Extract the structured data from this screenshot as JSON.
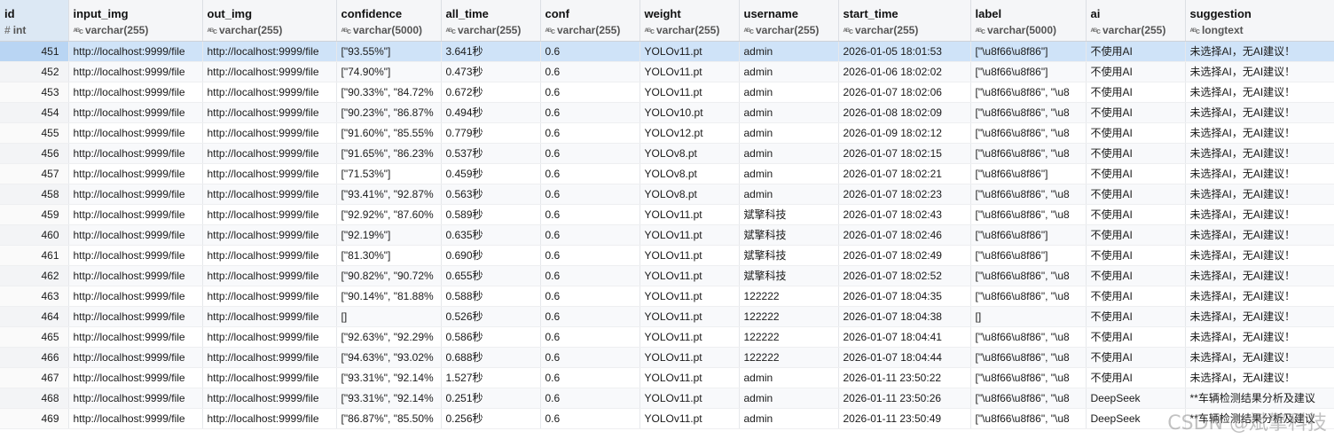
{
  "columns": [
    {
      "name": "id",
      "type": "int",
      "icon": "hash-icon"
    },
    {
      "name": "input_img",
      "type": "varchar(255)",
      "icon": "abc-icon"
    },
    {
      "name": "out_img",
      "type": "varchar(255)",
      "icon": "abc-icon"
    },
    {
      "name": "confidence",
      "type": "varchar(5000)",
      "icon": "abc-icon"
    },
    {
      "name": "all_time",
      "type": "varchar(255)",
      "icon": "abc-icon"
    },
    {
      "name": "conf",
      "type": "varchar(255)",
      "icon": "abc-icon"
    },
    {
      "name": "weight",
      "type": "varchar(255)",
      "icon": "abc-icon"
    },
    {
      "name": "username",
      "type": "varchar(255)",
      "icon": "abc-icon"
    },
    {
      "name": "start_time",
      "type": "varchar(255)",
      "icon": "abc-icon"
    },
    {
      "name": "label",
      "type": "varchar(5000)",
      "icon": "abc-icon"
    },
    {
      "name": "ai",
      "type": "varchar(255)",
      "icon": "abc-icon"
    },
    {
      "name": "suggestion",
      "type": "longtext",
      "icon": "abc-icon"
    }
  ],
  "type_icon_glyph": "ᴬᴮc",
  "hash_glyph": "#",
  "selected_row_index": 0,
  "colors": {
    "selected_row": "#cfe3f8",
    "header_bg": "#f5f6f8",
    "selected_header": "#dce8f4"
  },
  "rows": [
    [
      "451",
      "http://localhost:9999/file",
      "http://localhost:9999/file",
      "[\"93.55%\"]",
      "3.641秒",
      "0.6",
      "YOLOv11.pt",
      "admin",
      "2026-01-05 18:01:53",
      "[\"\\u8f66\\u8f86\"]",
      "不使用AI",
      "未选择AI，无AI建议！"
    ],
    [
      "452",
      "http://localhost:9999/file",
      "http://localhost:9999/file",
      "[\"74.90%\"]",
      "0.473秒",
      "0.6",
      "YOLOv11.pt",
      "admin",
      "2026-01-06 18:02:02",
      "[\"\\u8f66\\u8f86\"]",
      "不使用AI",
      "未选择AI，无AI建议！"
    ],
    [
      "453",
      "http://localhost:9999/file",
      "http://localhost:9999/file",
      "[\"90.33%\", \"84.72%",
      "0.672秒",
      "0.6",
      "YOLOv11.pt",
      "admin",
      "2026-01-07 18:02:06",
      "[\"\\u8f66\\u8f86\", \"\\u8",
      "不使用AI",
      "未选择AI，无AI建议！"
    ],
    [
      "454",
      "http://localhost:9999/file",
      "http://localhost:9999/file",
      "[\"90.23%\", \"86.87%",
      "0.494秒",
      "0.6",
      "YOLOv10.pt",
      "admin",
      "2026-01-08 18:02:09",
      "[\"\\u8f66\\u8f86\", \"\\u8",
      "不使用AI",
      "未选择AI，无AI建议！"
    ],
    [
      "455",
      "http://localhost:9999/file",
      "http://localhost:9999/file",
      "[\"91.60%\", \"85.55%",
      "0.779秒",
      "0.6",
      "YOLOv12.pt",
      "admin",
      "2026-01-09 18:02:12",
      "[\"\\u8f66\\u8f86\", \"\\u8",
      "不使用AI",
      "未选择AI，无AI建议！"
    ],
    [
      "456",
      "http://localhost:9999/file",
      "http://localhost:9999/file",
      "[\"91.65%\", \"86.23%",
      "0.537秒",
      "0.6",
      "YOLOv8.pt",
      "admin",
      "2026-01-07 18:02:15",
      "[\"\\u8f66\\u8f86\", \"\\u8",
      "不使用AI",
      "未选择AI，无AI建议！"
    ],
    [
      "457",
      "http://localhost:9999/file",
      "http://localhost:9999/file",
      "[\"71.53%\"]",
      "0.459秒",
      "0.6",
      "YOLOv8.pt",
      "admin",
      "2026-01-07 18:02:21",
      "[\"\\u8f66\\u8f86\"]",
      "不使用AI",
      "未选择AI，无AI建议！"
    ],
    [
      "458",
      "http://localhost:9999/file",
      "http://localhost:9999/file",
      "[\"93.41%\", \"92.87%",
      "0.563秒",
      "0.6",
      "YOLOv8.pt",
      "admin",
      "2026-01-07 18:02:23",
      "[\"\\u8f66\\u8f86\", \"\\u8",
      "不使用AI",
      "未选择AI，无AI建议！"
    ],
    [
      "459",
      "http://localhost:9999/file",
      "http://localhost:9999/file",
      "[\"92.92%\", \"87.60%",
      "0.589秒",
      "0.6",
      "YOLOv11.pt",
      "斌擎科技",
      "2026-01-07 18:02:43",
      "[\"\\u8f66\\u8f86\", \"\\u8",
      "不使用AI",
      "未选择AI，无AI建议！"
    ],
    [
      "460",
      "http://localhost:9999/file",
      "http://localhost:9999/file",
      "[\"92.19%\"]",
      "0.635秒",
      "0.6",
      "YOLOv11.pt",
      "斌擎科技",
      "2026-01-07 18:02:46",
      "[\"\\u8f66\\u8f86\"]",
      "不使用AI",
      "未选择AI，无AI建议！"
    ],
    [
      "461",
      "http://localhost:9999/file",
      "http://localhost:9999/file",
      "[\"81.30%\"]",
      "0.690秒",
      "0.6",
      "YOLOv11.pt",
      "斌擎科技",
      "2026-01-07 18:02:49",
      "[\"\\u8f66\\u8f86\"]",
      "不使用AI",
      "未选择AI，无AI建议！"
    ],
    [
      "462",
      "http://localhost:9999/file",
      "http://localhost:9999/file",
      "[\"90.82%\", \"90.72%",
      "0.655秒",
      "0.6",
      "YOLOv11.pt",
      "斌擎科技",
      "2026-01-07 18:02:52",
      "[\"\\u8f66\\u8f86\", \"\\u8",
      "不使用AI",
      "未选择AI，无AI建议！"
    ],
    [
      "463",
      "http://localhost:9999/file",
      "http://localhost:9999/file",
      "[\"90.14%\", \"81.88%",
      "0.588秒",
      "0.6",
      "YOLOv11.pt",
      "122222",
      "2026-01-07 18:04:35",
      "[\"\\u8f66\\u8f86\", \"\\u8",
      "不使用AI",
      "未选择AI，无AI建议！"
    ],
    [
      "464",
      "http://localhost:9999/file",
      "http://localhost:9999/file",
      "[]",
      "0.526秒",
      "0.6",
      "YOLOv11.pt",
      "122222",
      "2026-01-07 18:04:38",
      "[]",
      "不使用AI",
      "未选择AI，无AI建议！"
    ],
    [
      "465",
      "http://localhost:9999/file",
      "http://localhost:9999/file",
      "[\"92.63%\", \"92.29%",
      "0.586秒",
      "0.6",
      "YOLOv11.pt",
      "122222",
      "2026-01-07 18:04:41",
      "[\"\\u8f66\\u8f86\", \"\\u8",
      "不使用AI",
      "未选择AI，无AI建议！"
    ],
    [
      "466",
      "http://localhost:9999/file",
      "http://localhost:9999/file",
      "[\"94.63%\", \"93.02%",
      "0.688秒",
      "0.6",
      "YOLOv11.pt",
      "122222",
      "2026-01-07 18:04:44",
      "[\"\\u8f66\\u8f86\", \"\\u8",
      "不使用AI",
      "未选择AI，无AI建议！"
    ],
    [
      "467",
      "http://localhost:9999/file",
      "http://localhost:9999/file",
      "[\"93.31%\", \"92.14%",
      "1.527秒",
      "0.6",
      "YOLOv11.pt",
      "admin",
      "2026-01-11 23:50:22",
      "[\"\\u8f66\\u8f86\", \"\\u8",
      "不使用AI",
      "未选择AI，无AI建议！"
    ],
    [
      "468",
      "http://localhost:9999/file",
      "http://localhost:9999/file",
      "[\"93.31%\", \"92.14%",
      "0.251秒",
      "0.6",
      "YOLOv11.pt",
      "admin",
      "2026-01-11 23:50:26",
      "[\"\\u8f66\\u8f86\", \"\\u8",
      "DeepSeek",
      "**车辆检测结果分析及建议"
    ],
    [
      "469",
      "http://localhost:9999/file",
      "http://localhost:9999/file",
      "[\"86.87%\", \"85.50%",
      "0.256秒",
      "0.6",
      "YOLOv11.pt",
      "admin",
      "2026-01-11 23:50:49",
      "[\"\\u8f66\\u8f86\", \"\\u8",
      "DeepSeek",
      "**车辆检测结果分析及建议"
    ]
  ],
  "watermark": "CSDN @斌擎科技"
}
